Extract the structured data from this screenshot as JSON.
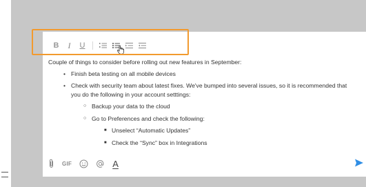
{
  "toolbar": {
    "bold_label": "B",
    "italic_label": "I",
    "underline_label": "U",
    "icons": [
      "numbered-list-icon",
      "bulleted-list-icon",
      "outdent-icon",
      "indent-icon"
    ]
  },
  "editor": {
    "intro": "Couple of things to consider before rolling out new features in September:",
    "items": [
      "Finish beta testing on all mobile devices",
      "Check with security team about latest fixes. We've bumped into several issues, so it is recommended that you do the following in your account setttings:"
    ],
    "sub_items": [
      "Backup your data to the cloud",
      "Go to Preferences and check the following:"
    ],
    "sub_sub_items": [
      "Unselect “Automatic Updates”",
      "Check the “Sync” box in Integrations"
    ]
  },
  "bottom_bar": {
    "gif_label": "GIF",
    "font_label": "A",
    "icons": [
      "attachment-icon",
      "emoji-icon",
      "mention-icon",
      "send-icon"
    ]
  },
  "colors": {
    "frame": "#c7c7c7",
    "highlight": "#f29a2e",
    "send": "#2f8ee5",
    "icon": "#8a8a8a"
  }
}
